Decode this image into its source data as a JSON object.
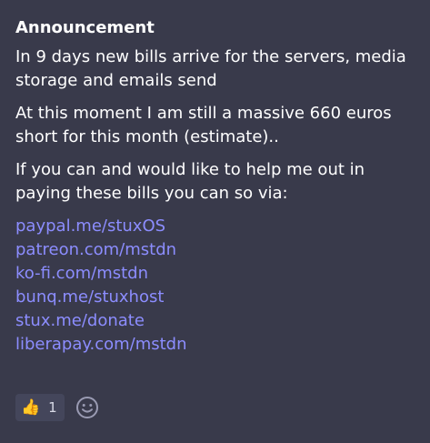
{
  "post": {
    "title": "Announcement",
    "paragraphs": [
      "In 9 days new bills arrive for the servers, media storage and emails send",
      "At this moment I am still a massive 660 euros short for this month (estimate)..",
      "If you can and would like to help me out in paying these bills you can so via:"
    ],
    "links": [
      "paypal.me/stuxOS",
      "patreon.com/mstdn",
      "ko-fi.com/mstdn",
      "bunq.me/stuxhost",
      "stux.me/donate",
      "liberapay.com/mstdn"
    ]
  },
  "reactions": {
    "items": [
      {
        "emoji": "👍",
        "count": "1",
        "icon": "thumbs-up-icon"
      }
    ],
    "add_icon": "smiley-face-icon"
  },
  "colors": {
    "background": "#393a4b",
    "link": "#8c8dff",
    "reaction_bg": "#44465b",
    "muted": "#9a9bb3"
  }
}
